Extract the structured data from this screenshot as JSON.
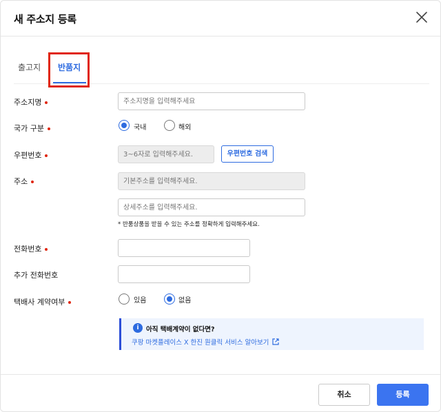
{
  "modal": {
    "title": "새 주소지 등록"
  },
  "tabs": [
    {
      "label": "출고지",
      "active": false
    },
    {
      "label": "반품지",
      "active": true
    }
  ],
  "form": {
    "address_name": {
      "label": "주소지명",
      "required": true,
      "placeholder": "주소지명을 입력해주세요",
      "value": ""
    },
    "country": {
      "label": "국가 구분",
      "required": true,
      "options": [
        {
          "label": "국내",
          "selected": true
        },
        {
          "label": "해외",
          "selected": false
        }
      ]
    },
    "postcode": {
      "label": "우편번호",
      "required": true,
      "placeholder": "3~6자로 입력해주세요.",
      "button_label": "우편번호 검색"
    },
    "address": {
      "label": "주소",
      "required": true,
      "basic_placeholder": "기본주소를 입력해주세요.",
      "detail_placeholder": "상세주소를 입력해주세요.",
      "hint": "* 반품상품을 받을 수 있는 주소를 정확하게 입력해주세요."
    },
    "phone": {
      "label": "전화번호",
      "required": true,
      "value": ""
    },
    "extra_phone": {
      "label": "추가 전화번호",
      "required": false,
      "value": ""
    },
    "courier_contract": {
      "label": "택배사 계약여부",
      "required": true,
      "options": [
        {
          "label": "있음",
          "selected": false
        },
        {
          "label": "없음",
          "selected": true
        }
      ]
    }
  },
  "info": {
    "icon": "info-icon",
    "title": "아직 택배계약이 없다면?",
    "link_text": "쿠팡 마켓플레이스 X 한진 원클릭 서비스 알아보기"
  },
  "footer": {
    "cancel_label": "취소",
    "submit_label": "등록"
  },
  "colors": {
    "accent": "#2d6be0",
    "required_dot": "#e0260f",
    "submit_bg": "#3b74f0",
    "info_bg": "#eef4fe"
  }
}
